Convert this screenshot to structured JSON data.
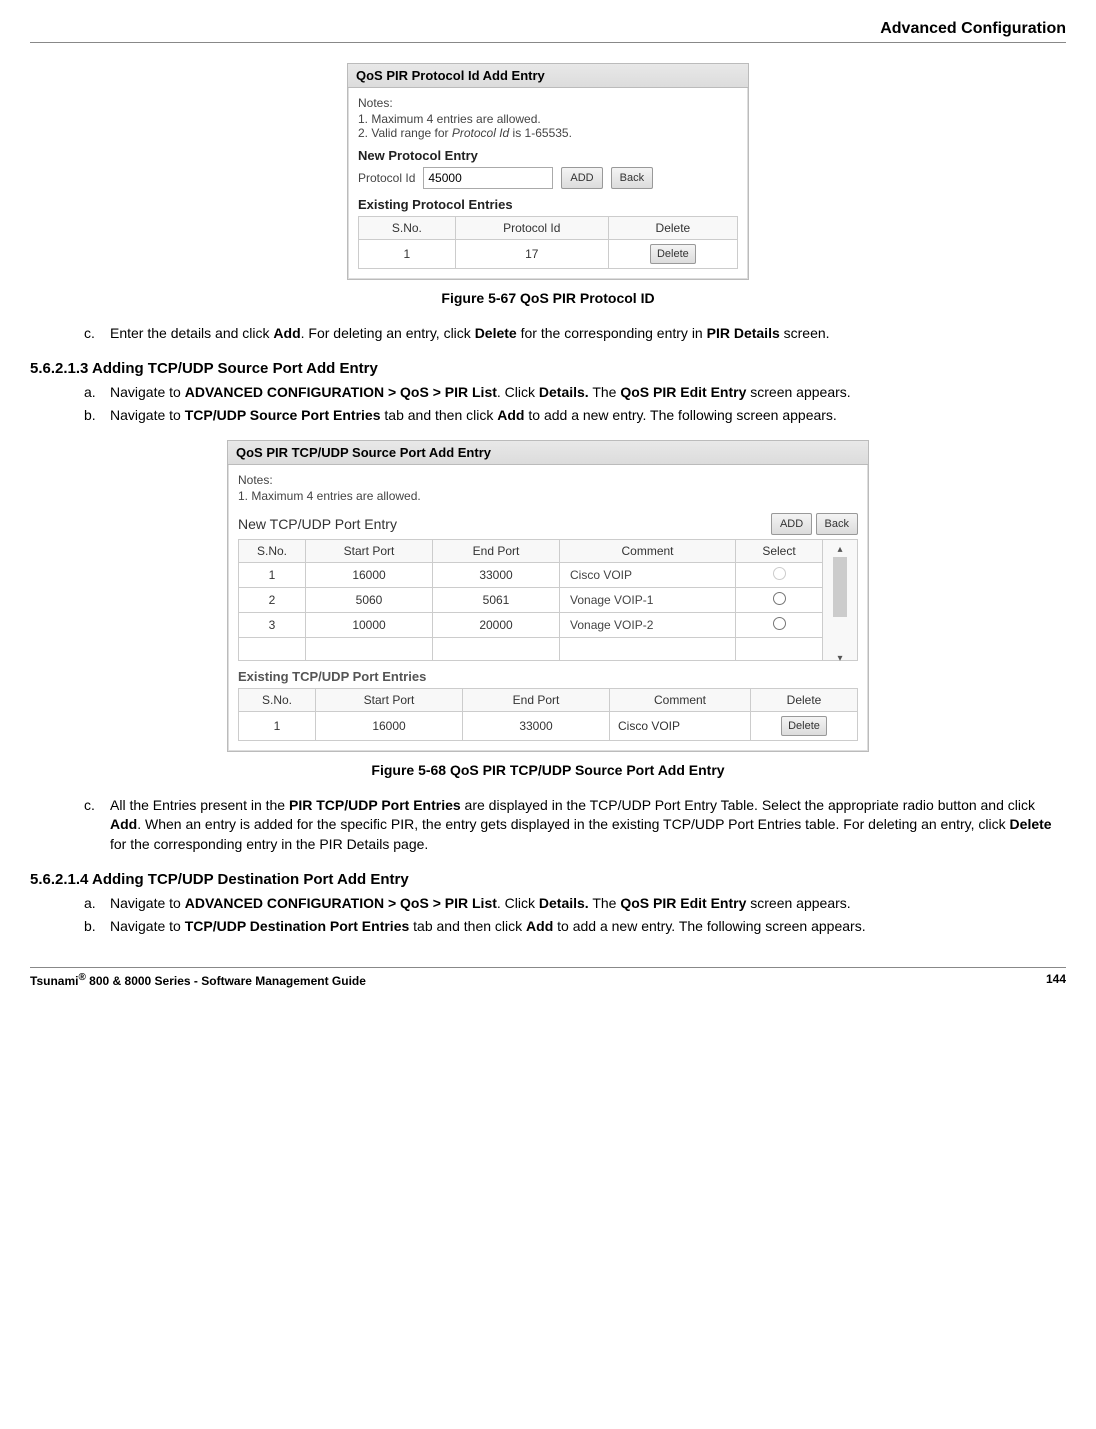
{
  "header": {
    "title": "Advanced Configuration"
  },
  "footer": {
    "left": "Tsunami® 800 & 8000 Series - Software Management Guide",
    "right": "144"
  },
  "dialog1": {
    "title": "QoS PIR Protocol Id Add Entry",
    "notes_head": "Notes:",
    "note1": "1. Maximum 4 entries are allowed.",
    "note2": "2. Valid range for Protocol Id is 1-65535.",
    "new_section": "New Protocol Entry",
    "field_label": "Protocol Id",
    "field_value": "45000",
    "btn_add": "ADD",
    "btn_back": "Back",
    "existing_section": "Existing Protocol Entries",
    "col_sno": "S.No.",
    "col_pid": "Protocol Id",
    "col_del": "Delete",
    "row_sno": "1",
    "row_pid": "17",
    "btn_delete": "Delete"
  },
  "caption1": "Figure 5-67 QoS PIR Protocol ID",
  "para_c1_a": "Enter the details and click ",
  "para_c1_b": "Add",
  "para_c1_c": ". For deleting an entry, click ",
  "para_c1_d": "Delete",
  "para_c1_e": " for the corresponding entry in ",
  "para_c1_f": "PIR Details",
  "para_c1_g": " screen.",
  "heading1": "5.6.2.1.3 Adding TCP/UDP Source Port Add Entry",
  "s1a_1": "Navigate to ",
  "s1a_2": "ADVANCED CONFIGURATION > QoS > PIR List",
  "s1a_3": ". Click ",
  "s1a_4": "Details.",
  "s1a_5": " The ",
  "s1a_6": "QoS PIR Edit Entry",
  "s1a_7": " screen appears.",
  "s1b_1": "Navigate to ",
  "s1b_2": "TCP/UDP Source Port Entries",
  "s1b_3": " tab and then click ",
  "s1b_4": "Add",
  "s1b_5": " to add a new entry. The following screen appears.",
  "dialog2": {
    "title": "QoS PIR TCP/UDP Source Port Add Entry",
    "notes_head": "Notes:",
    "note1": "1. Maximum 4 entries are allowed.",
    "new_section": "New TCP/UDP Port Entry",
    "btn_add": "ADD",
    "btn_back": "Back",
    "new_cols": {
      "sno": "S.No.",
      "start": "Start Port",
      "end": "End Port",
      "comment": "Comment",
      "select": "Select"
    },
    "new_rows": [
      {
        "sno": "1",
        "start": "16000",
        "end": "33000",
        "comment": "Cisco VOIP"
      },
      {
        "sno": "2",
        "start": "5060",
        "end": "5061",
        "comment": "Vonage VOIP-1"
      },
      {
        "sno": "3",
        "start": "10000",
        "end": "20000",
        "comment": "Vonage VOIP-2"
      }
    ],
    "existing_section": "Existing TCP/UDP Port Entries",
    "ex_cols": {
      "sno": "S.No.",
      "start": "Start Port",
      "end": "End Port",
      "comment": "Comment",
      "del": "Delete"
    },
    "ex_row": {
      "sno": "1",
      "start": "16000",
      "end": "33000",
      "comment": "Cisco VOIP"
    },
    "btn_delete": "Delete"
  },
  "caption2": "Figure 5-68 QoS PIR TCP/UDP Source Port Add Entry",
  "s1c_1": "All the Entries present in the ",
  "s1c_2": "PIR TCP/UDP Port Entries",
  "s1c_3": " are displayed in the TCP/UDP Port Entry Table. Select the appropriate radio button and click ",
  "s1c_4": "Add",
  "s1c_5": ". When an entry is added for the specific PIR, the entry gets displayed in the existing TCP/UDP Port Entries table. For deleting an entry, click ",
  "s1c_6": "Delete",
  "s1c_7": " for the corresponding entry in the PIR Details page.",
  "heading2": "5.6.2.1.4 Adding TCP/UDP Destination Port Add Entry",
  "s2a_1": "Navigate to ",
  "s2a_2": "ADVANCED CONFIGURATION > QoS > PIR List",
  "s2a_3": ". Click ",
  "s2a_4": "Details.",
  "s2a_5": " The ",
  "s2a_6": "QoS PIR Edit Entry",
  "s2a_7": " screen appears.",
  "s2b_1": "Navigate to ",
  "s2b_2": "TCP/UDP Destination Port Entries",
  "s2b_3": " tab and then click ",
  "s2b_4": "Add",
  "s2b_5": " to add a new entry. The following screen appears."
}
